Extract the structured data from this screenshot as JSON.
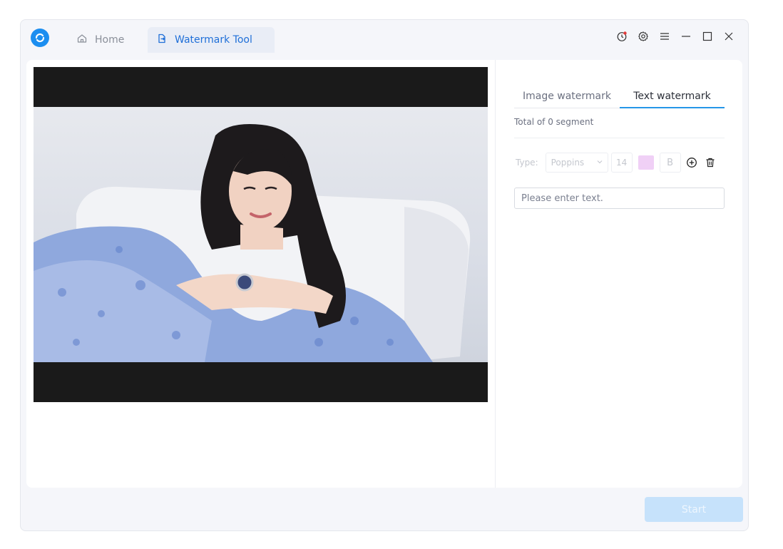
{
  "titlebar": {
    "tabs": [
      {
        "label": "Home",
        "icon": "home-icon"
      },
      {
        "label": "Watermark Tool",
        "icon": "watermark-tool-icon"
      }
    ],
    "controls": [
      "history-icon",
      "settings-icon",
      "menu-icon",
      "minimize-icon",
      "maximize-icon",
      "close-icon"
    ]
  },
  "right_panel": {
    "tabs": {
      "image": "Image watermark",
      "text": "Text watermark"
    },
    "active_tab": "Text watermark",
    "segment_count": "Total of 0 segment",
    "type_label": "Type:",
    "font": "Poppins",
    "font_size": "14",
    "color": "#f0d0f6",
    "bold_label": "B",
    "text_placeholder": "Please enter text."
  },
  "footer": {
    "start_label": "Start"
  },
  "colors": {
    "accent": "#2596e8",
    "start_disabled": "#c6e2fb",
    "swatch": "#f0d0f6"
  }
}
